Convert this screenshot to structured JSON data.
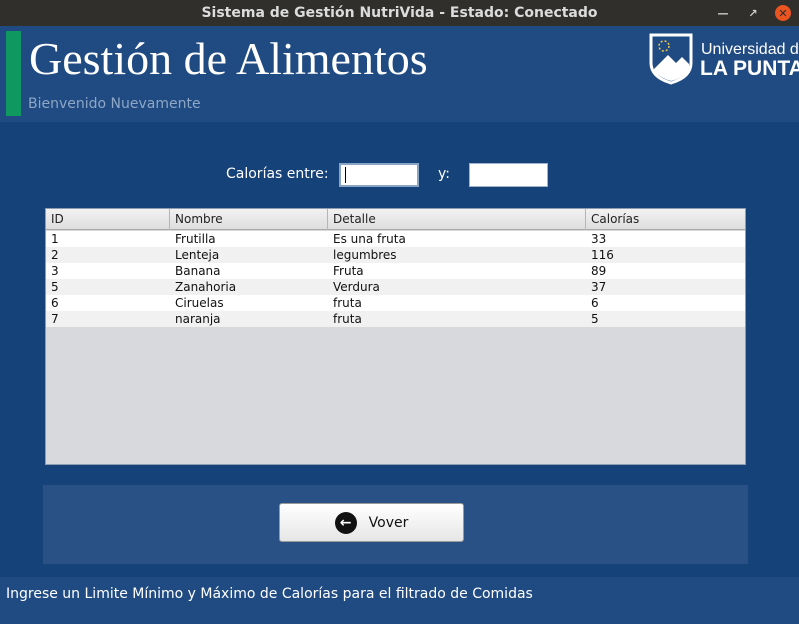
{
  "window": {
    "title": "Sistema de Gestión NutriVida - Estado: Conectado"
  },
  "header": {
    "title": "Gestión de Alimentos",
    "subtitle": "Bienvenido Nuevamente",
    "logo_line1": "Universidad de",
    "logo_line2": "LA PUNTA"
  },
  "filter": {
    "label": "Calorías entre:",
    "and_label": "y:",
    "min_value": "",
    "max_value": ""
  },
  "table": {
    "columns": [
      "ID",
      "Nombre",
      "Detalle",
      "Calorías"
    ],
    "rows": [
      [
        "1",
        "Frutilla",
        "Es una fruta",
        "33"
      ],
      [
        "2",
        "Lenteja",
        "legumbres",
        "116"
      ],
      [
        "3",
        "Banana",
        "Fruta",
        "89"
      ],
      [
        "5",
        "Zanahoria",
        "Verdura",
        "37"
      ],
      [
        "6",
        "Ciruelas",
        "fruta",
        "6"
      ],
      [
        "7",
        "naranja",
        "fruta",
        "5"
      ]
    ]
  },
  "actions": {
    "back_label": "Vover"
  },
  "status": {
    "text": "Ingrese un Limite Mínimo y Máximo de Calorías para el filtrado de Comidas"
  },
  "colors": {
    "background": "#16427a",
    "header": "#1f4a82",
    "accent": "#0f9960"
  },
  "icons": {
    "back": "arrow-left-circle-icon",
    "logo": "university-shield-logo"
  }
}
